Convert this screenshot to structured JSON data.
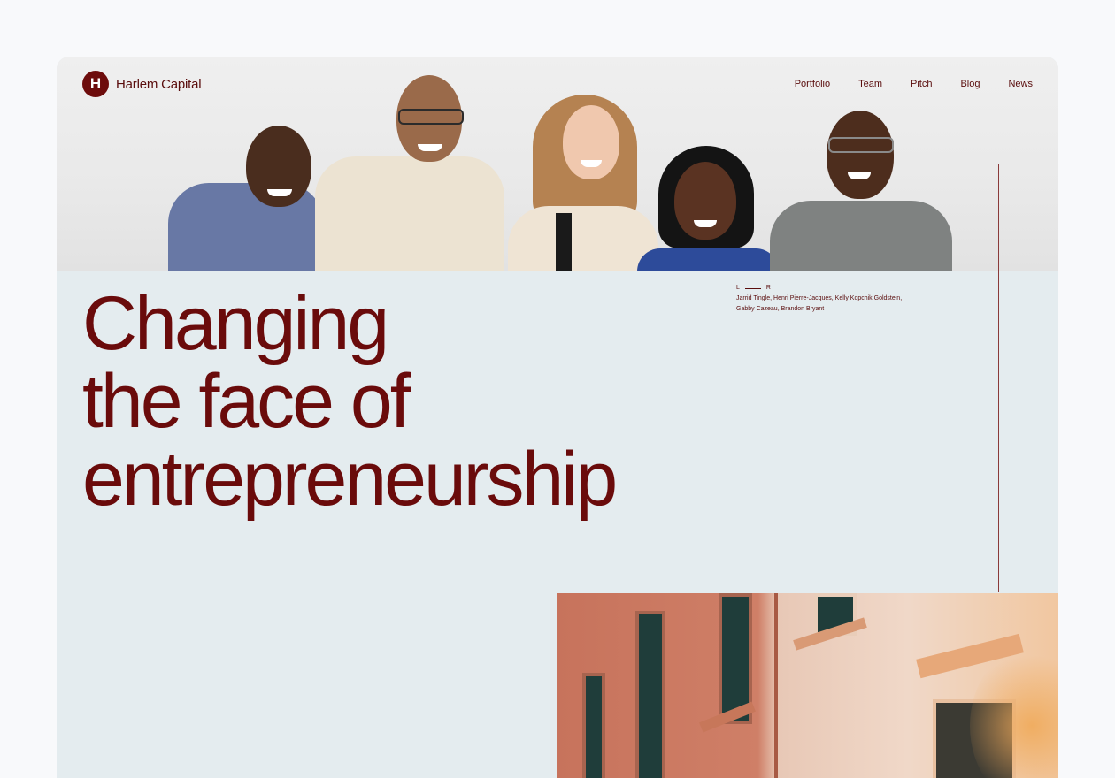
{
  "brand": {
    "logo_letter": "H",
    "name": "Harlem Capital"
  },
  "nav": [
    "Portfolio",
    "Team",
    "Pitch",
    "Blog",
    "News"
  ],
  "hero": {
    "headline_lines": [
      "Changing",
      "the face of",
      "entrepreneurship"
    ],
    "caption": {
      "left_label": "L",
      "right_label": "R",
      "line1": "Jarrid Tingle, Henri Pierre-Jacques, Kelly Kopchik Goldstein,",
      "line2": "Gabby Cazeau, Brandon Bryant"
    }
  },
  "colors": {
    "accent": "#6a0b0b",
    "background": "#e4ecef",
    "page": "#f8f9fb"
  },
  "icons": {
    "logo": "harlem-capital-logo-icon"
  }
}
